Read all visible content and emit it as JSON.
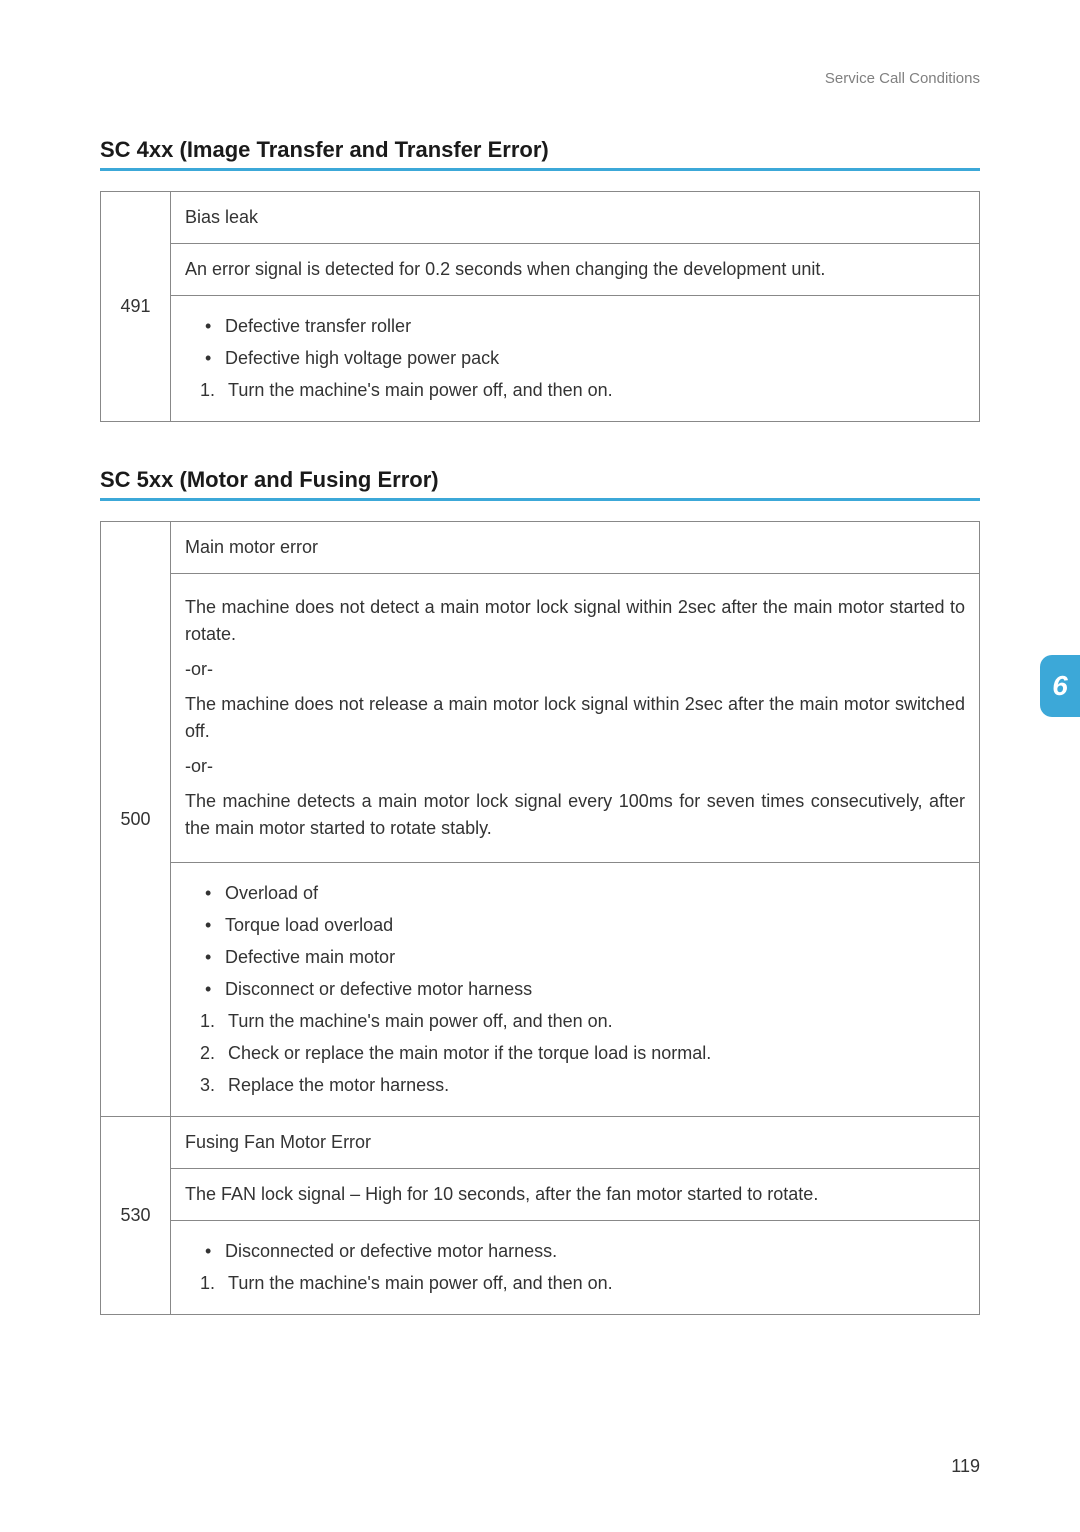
{
  "header": "Service Call Conditions",
  "sections": [
    {
      "title": "SC 4xx (Image Transfer and Transfer Error)",
      "rows": [
        {
          "code": "491",
          "title": "Bias leak",
          "desc": "An error signal is detected for 0.2 seconds when changing the development unit.",
          "bullets": [
            "Defective transfer roller",
            "Defective high voltage power pack"
          ],
          "steps": [
            "Turn the machine's main power off, and then on."
          ]
        }
      ]
    },
    {
      "title": "SC 5xx (Motor and Fusing Error)",
      "rows": [
        {
          "code": "500",
          "title": "Main motor error",
          "desc_parts": [
            "The machine does not detect a main motor lock signal within 2sec after the main motor started to rotate.",
            "-or-",
            "The machine does not release a main motor lock signal within 2sec after the main motor switched off.",
            "-or-",
            "The machine detects a main motor lock signal every 100ms for seven times consecutively, after the main motor started to rotate stably."
          ],
          "bullets": [
            "Overload of",
            "Torque load overload",
            "Defective main motor",
            "Disconnect or defective motor harness"
          ],
          "steps": [
            "Turn the machine's main power off, and then on.",
            "Check or replace the main motor if the torque load is normal.",
            "Replace the motor harness."
          ]
        },
        {
          "code": "530",
          "title": "Fusing Fan Motor Error",
          "desc": "The FAN lock signal – High for 10 seconds, after the fan motor started to rotate.",
          "bullets": [
            "Disconnected or defective motor harness."
          ],
          "steps": [
            "Turn the machine's main power off, and then on."
          ]
        }
      ]
    }
  ],
  "side_tab": "6",
  "page_number": "119"
}
